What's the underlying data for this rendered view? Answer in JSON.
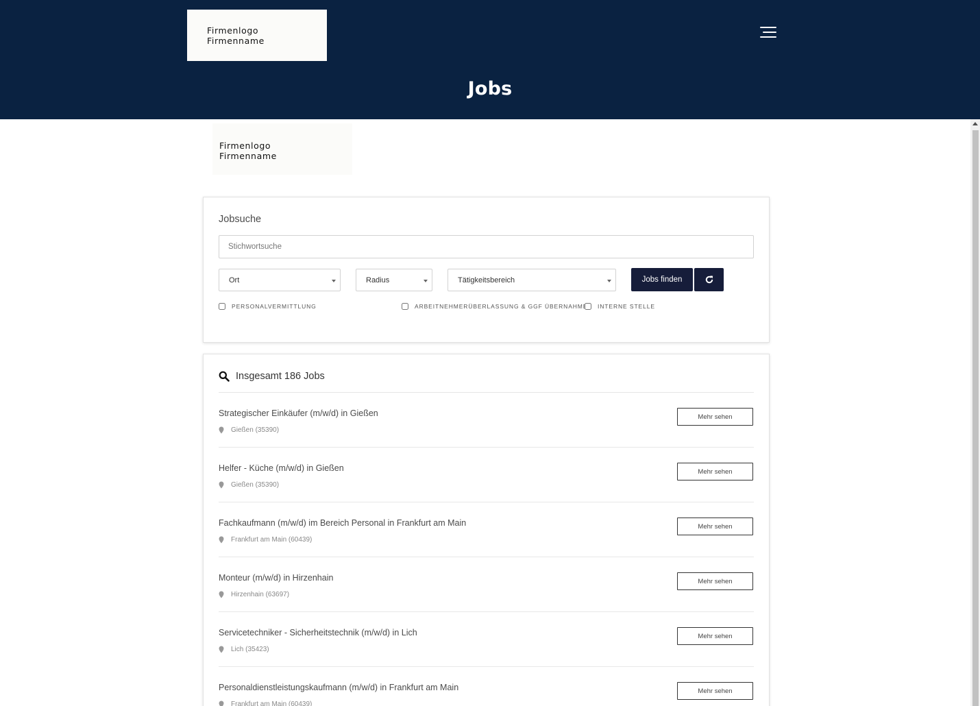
{
  "header": {
    "logo_line1": "Firmenlogo",
    "logo_line2": "Firmenname",
    "title": "Jobs",
    "menu_icon": "hamburger-menu-icon"
  },
  "company": {
    "logo_line1": "Firmenlogo",
    "logo_line2": "Firmenname"
  },
  "search": {
    "title": "Jobsuche",
    "keyword_placeholder": "Stichwortsuche",
    "location_label": "Ort",
    "radius_label": "Radius",
    "category_label": "Tätigkeitsbereich",
    "find_button": "Jobs finden",
    "reset_icon": "refresh-icon",
    "filters": [
      {
        "label": "PERSONALVERMITTLUNG",
        "checked": false
      },
      {
        "label": "ARBEITNEHMERÜBERLASSUNG & GGF ÜBERNAHME",
        "checked": false
      },
      {
        "label": "INTERNE STELLE",
        "checked": false
      }
    ]
  },
  "results": {
    "count_text": "Insgesamt 186 Jobs",
    "more_label": "Mehr sehen",
    "jobs": [
      {
        "title": "Strategischer Einkäufer (m/w/d) in Gießen",
        "location": "Gießen (35390)"
      },
      {
        "title": "Helfer - Küche (m/w/d) in Gießen",
        "location": "Gießen (35390)"
      },
      {
        "title": "Fachkaufmann (m/w/d) im Bereich Personal in Frankfurt am Main",
        "location": "Frankfurt am Main (60439)"
      },
      {
        "title": "Monteur (m/w/d) in Hirzenhain",
        "location": "Hirzenhain (63697)"
      },
      {
        "title": "Servicetechniker - Sicherheitstechnik (m/w/d) in Lich",
        "location": "Lich (35423)"
      },
      {
        "title": "Personaldienstleistungskaufmann (m/w/d) in Frankfurt am Main",
        "location": "Frankfurt am Main (60439)"
      }
    ]
  },
  "colors": {
    "header_bg": "#0a2241",
    "button_bg": "#161d3a"
  }
}
